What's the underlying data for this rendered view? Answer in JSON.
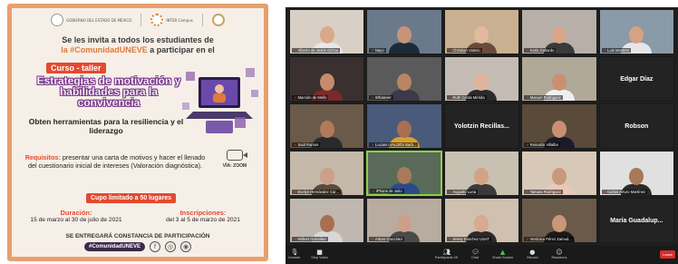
{
  "poster": {
    "logos": [
      "GOBIERNO DEL ESTADO DE MÉXICO",
      "INTER Campus",
      "UNEVE"
    ],
    "invite_line1": "Se les invita a todos los estudiantes de",
    "invite_hash": "la #ComunidadUNEVE",
    "invite_line2": "a participar en el",
    "curso_tag": "Curso - taller",
    "title": "Estrategias de motivación y habilidades para la convivencia",
    "subtitle": "Obten herramientas para la resiliencia y el liderazgo",
    "requisitos_label": "Requisitos:",
    "requisitos_text": "presentar una carta de motivos y hacer el llenado del cuestionario inicial de intereses (Valoración diagnóstica).",
    "via": "VÍA: ZOOM",
    "cupo": "Cupo limitado a 50 lugares",
    "duracion_label": "Duración:",
    "duracion_text": "15 de marzo al 30 de julio de 2021",
    "inscripciones_label": "Inscripciones:",
    "inscripciones_text": "del 3 al 5 de marzo de 2021",
    "constancia": "SE ENTREGARÁ CONSTANCIA DE PARTICIPACIÓN",
    "footer_tag": "#ComunidadUNEVE"
  },
  "zoom": {
    "tiles": [
      {
        "name": "Alberto de Jesús Ochoa",
        "type": "video",
        "bg": "#d8d0c4",
        "skin": "#d9a98a",
        "shirt": "#e8e8e8"
      },
      {
        "name": "Nayo",
        "type": "video",
        "bg": "#6a7a8a",
        "skin": "#c89478",
        "shirt": "#1c2a3a"
      },
      {
        "name": "Christian Valerio",
        "type": "video",
        "bg": "#c8b090",
        "skin": "#e3b9a0",
        "shirt": "#6a4a3a"
      },
      {
        "name": "Karla Gallardo",
        "type": "video",
        "bg": "#b8b0a8",
        "skin": "#d7a68a",
        "shirt": "#3a3a3a"
      },
      {
        "name": "Luis Montero",
        "type": "video",
        "bg": "#8a9aa8",
        "skin": "#d6a284",
        "shirt": "#e6e6e6"
      },
      {
        "name": "Marcelo de Mello",
        "type": "video",
        "bg": "#3a3030",
        "skin": "#c58b6a",
        "shirt": "#7a2a2a"
      },
      {
        "name": "Whatever",
        "type": "video",
        "bg": "#5a5a5a",
        "skin": "#b88464",
        "shirt": "#3a3a4a"
      },
      {
        "name": "Ruth Cerda Mérida",
        "type": "video",
        "bg": "#c4bcb4",
        "skin": "#e0b49a",
        "shirt": "#2a2a2a"
      },
      {
        "name": "Manuel Rodriguez",
        "type": "video",
        "bg": "#b0a898",
        "skin": "#c99070",
        "shirt": "#f0f0f0"
      },
      {
        "name": "Edgar Díaz",
        "type": "name"
      },
      {
        "name": "Saúl Ramos",
        "type": "video",
        "bg": "#6a5a4a",
        "skin": "#b27a5a",
        "shirt": "#2a2a2a"
      },
      {
        "name": "Luciano VALDÉS Barb...",
        "type": "video",
        "bg": "#4a5a7a",
        "skin": "#a87050",
        "shirt": "#d8a030"
      },
      {
        "name": "Yolotzin Recillas...",
        "type": "name"
      },
      {
        "name": "Reinaldo Villalba",
        "type": "video",
        "bg": "#5a4a3a",
        "skin": "#c89070",
        "shirt": "#1a1a2a"
      },
      {
        "name": "Robson",
        "type": "name"
      },
      {
        "name": "Evelyn Hernández Car...",
        "type": "video",
        "bg": "#c4b8a8",
        "skin": "#caa088",
        "shirt": "#5a4a3a"
      },
      {
        "name": "iPhone de Julio",
        "type": "video",
        "active": true,
        "bg": "#5a6a5a",
        "skin": "#a87a5a",
        "shirt": "#2a4a8a"
      },
      {
        "name": "Augusto Luna",
        "type": "video",
        "bg": "#c8c0b0",
        "skin": "#d2a486",
        "shirt": "#3a3a3a"
      },
      {
        "name": "Tamara Rodriguez",
        "type": "video",
        "bg": "#d8c8b8",
        "skin": "#c8987a",
        "shirt": "#e8c8b8"
      },
      {
        "name": "Carlos Arturo Martínez",
        "type": "video",
        "bg": "#e0e0e0",
        "skin": "#a87858",
        "shirt": "#2a2a2a"
      },
      {
        "name": "Hébert González",
        "type": "video",
        "bg": "#c0b8b0",
        "skin": "#a87050",
        "shirt": "#d8d8d8"
      },
      {
        "name": "Arturo González",
        "type": "video",
        "bg": "#b8aca0",
        "skin": "#caa088",
        "shirt": "#4a4a4a"
      },
      {
        "name": "Jenny Sánchez USAT",
        "type": "video",
        "bg": "#d0c0b0",
        "skin": "#d8aa8e",
        "shirt": "#2a2a2a"
      },
      {
        "name": "Verónica Pérez Zamud...",
        "type": "video",
        "bg": "#6a5a4a",
        "skin": "#c89878",
        "shirt": "#1a1a1a"
      },
      {
        "name": "María Guadalup...",
        "type": "name"
      }
    ],
    "toolbar": {
      "mute": "Unmute",
      "video": "Stop Video",
      "participants": "Participants",
      "participants_count": "25",
      "chat": "Chat",
      "share": "Share Screen",
      "record": "Record",
      "reactions": "Reactions",
      "leave": "Leave"
    }
  }
}
